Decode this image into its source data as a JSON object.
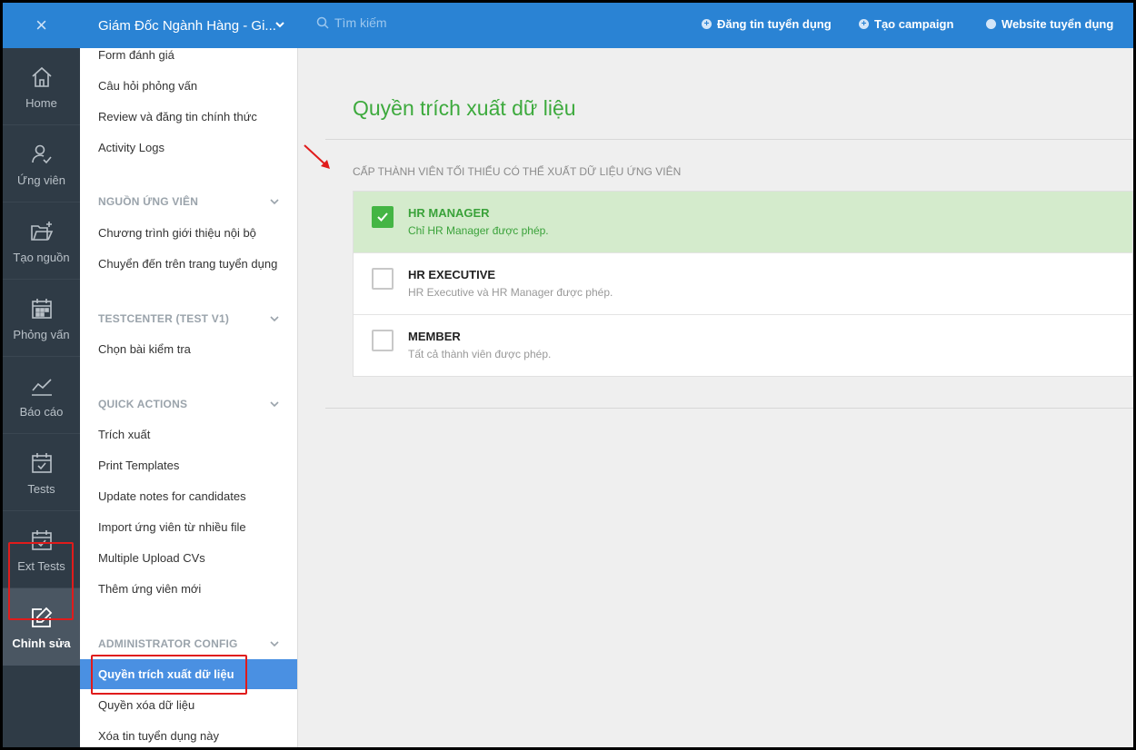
{
  "rail": {
    "close_glyph": "×",
    "items": [
      {
        "label": "Home",
        "icon": "home-icon"
      },
      {
        "label": "Ứng viên",
        "icon": "user-check-icon"
      },
      {
        "label": "Tạo nguồn",
        "icon": "folder-plus-icon"
      },
      {
        "label": "Phỏng vấn",
        "icon": "calendar-icon"
      },
      {
        "label": "Báo cáo",
        "icon": "chart-line-icon"
      },
      {
        "label": "Tests",
        "icon": "calendar-check-icon"
      },
      {
        "label": "Ext Tests",
        "icon": "calendar-check-icon"
      },
      {
        "label": "Chỉnh sửa",
        "icon": "edit-icon"
      }
    ]
  },
  "sidebar": {
    "header": "Giám Đốc Ngành Hàng - Gi...",
    "top_items": [
      "Form đánh giá",
      "Câu hỏi phỏng vấn",
      "Review và đăng tin chính thức",
      "Activity Logs"
    ],
    "sections": [
      {
        "title": "NGUỒN ỨNG VIÊN",
        "items": [
          "Chương trình giới thiệu nội bộ",
          "Chuyển đến trên trang tuyển dụng"
        ]
      },
      {
        "title": "TESTCENTER (TEST V1)",
        "items": [
          "Chọn bài kiểm tra"
        ]
      },
      {
        "title": "QUICK ACTIONS",
        "items": [
          "Trích xuất",
          "Print Templates",
          "Update notes for candidates",
          "Import ứng viên từ nhiều file",
          "Multiple Upload CVs",
          "Thêm ứng viên mới"
        ]
      },
      {
        "title": "ADMINISTRATOR CONFIG",
        "items": [
          "Quyền trích xuất dữ liệu",
          "Quyền xóa dữ liệu",
          "Xóa tin tuyển dụng này"
        ]
      }
    ]
  },
  "topbar": {
    "search_placeholder": "Tìm kiếm",
    "links": [
      "Đăng tin tuyển dụng",
      "Tạo campaign",
      "Website tuyển dụng"
    ]
  },
  "main": {
    "title": "Quyền trích xuất dữ liệu",
    "field_label": "CẤP THÀNH VIÊN TỐI THIỂU CÓ THỂ XUẤT DỮ LIỆU ỨNG VIÊN",
    "options": [
      {
        "title": "HR MANAGER",
        "desc": "Chỉ HR Manager được phép.",
        "checked": true
      },
      {
        "title": "HR EXECUTIVE",
        "desc": "HR Executive và HR Manager được phép.",
        "checked": false
      },
      {
        "title": "MEMBER",
        "desc": "Tất cả thành viên được phép.",
        "checked": false
      }
    ]
  },
  "colors": {
    "brand_blue": "#2a83d4",
    "accent_green": "#3daa3d",
    "highlight_red": "#e01b1b"
  }
}
